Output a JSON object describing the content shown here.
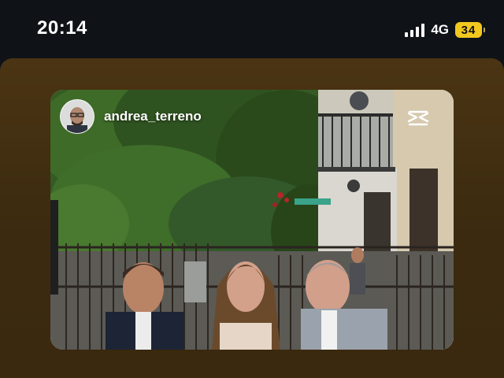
{
  "status_bar": {
    "time": "20:14",
    "network": "4G",
    "battery_level": "34",
    "signal_bars": 4,
    "icons": [
      "signal-icon",
      "battery-icon"
    ]
  },
  "story": {
    "background_color": "#4a3413",
    "shared_post": {
      "author_username": "andrea_terreno",
      "avatar_icon": "avatar",
      "corner_icon": "capcut-icon"
    }
  },
  "colors": {
    "status_bar_bg": "#0f1318",
    "battery_fill": "#f2c81f"
  }
}
